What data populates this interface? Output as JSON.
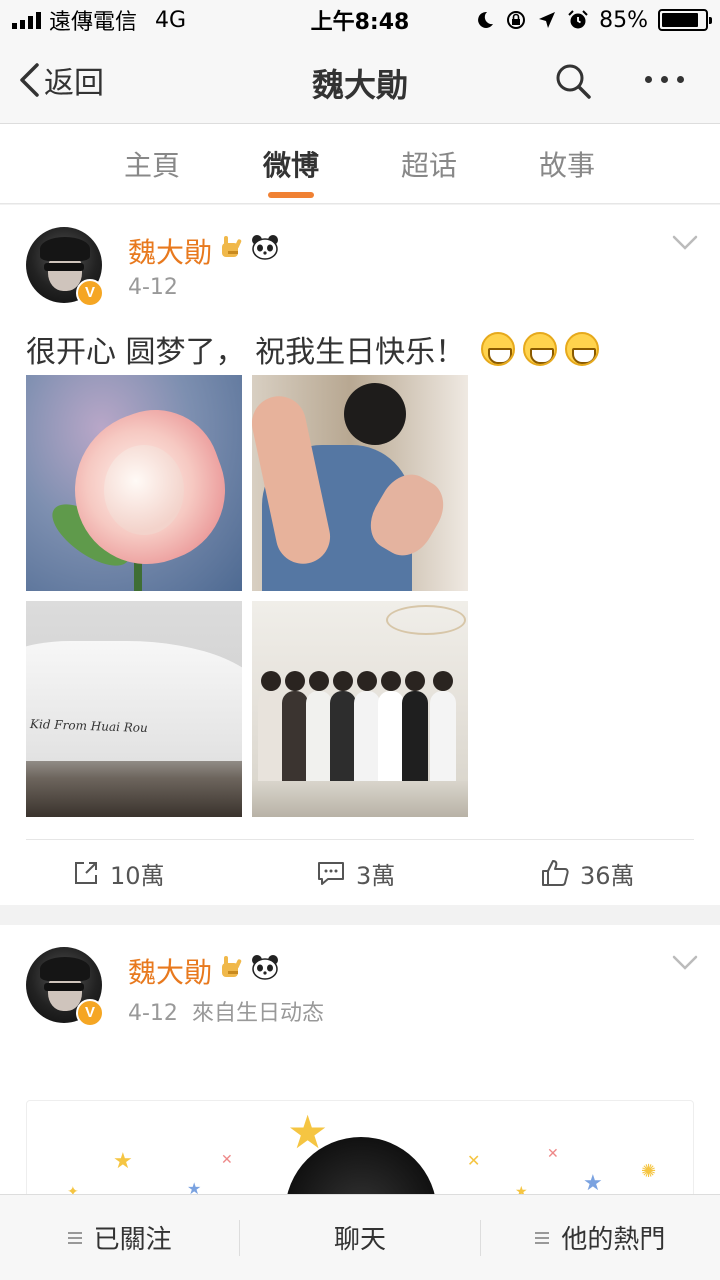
{
  "status_bar": {
    "carrier": "遠傳電信",
    "network": "4G",
    "time": "上午8:48",
    "battery_percent": "85%",
    "battery_level": 0.85
  },
  "nav": {
    "back_label": "返回",
    "title": "魏大勛",
    "search_icon": "search-icon",
    "more_icon": "more-icon"
  },
  "tabs": [
    {
      "label": "主頁",
      "active": false
    },
    {
      "label": "微博",
      "active": true
    },
    {
      "label": "超话",
      "active": false
    },
    {
      "label": "故事",
      "active": false
    }
  ],
  "colors": {
    "accent": "#f08133",
    "username": "#e8791e",
    "verified": "#f5a623"
  },
  "posts": [
    {
      "author": "魏大勛",
      "date": "4-12",
      "source": "",
      "text": "很开心 圆梦了， 祝我生日快乐！",
      "emoji_count": 3,
      "emoji_icon": "grin-emoji-icon",
      "photos": [
        {
          "name": "rose-photo"
        },
        {
          "name": "waving-hand-photo"
        },
        {
          "name": "sneaker-photo",
          "caption": "Kid From Huai Rou"
        },
        {
          "name": "group-photo"
        }
      ],
      "actions": {
        "repost": "10萬",
        "comment": "3萬",
        "like": "36萬"
      }
    },
    {
      "author": "魏大勛",
      "date": "4-12",
      "source": "來自生日动态"
    }
  ],
  "bottom_bar": {
    "follow": "已關注",
    "chat": "聊天",
    "hot": "他的熱門"
  }
}
